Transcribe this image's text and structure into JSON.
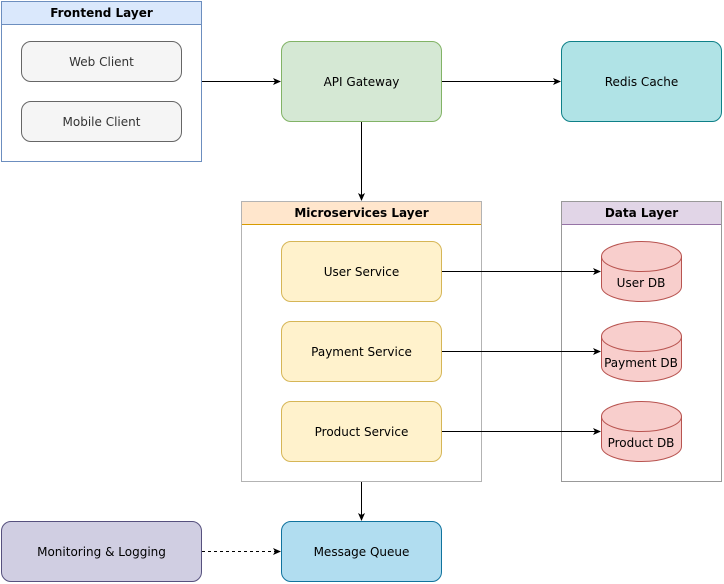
{
  "containers": {
    "frontend": {
      "title": "Frontend Layer",
      "fill": "#dae8fc",
      "stroke": "#6c8ebf"
    },
    "microservices": {
      "title": "Microservices Layer",
      "fill": "#ffe6cc",
      "stroke": "#d79b00"
    },
    "data": {
      "title": "Data Layer",
      "fill": "#e1d5e7",
      "stroke": "#9673a6"
    }
  },
  "nodes": {
    "web_client": "Web Client",
    "mobile_client": "Mobile Client",
    "api_gateway": "API Gateway",
    "redis_cache": "Redis Cache",
    "user_service": "User Service",
    "payment_service": "Payment Service",
    "product_service": "Product Service",
    "user_db": "User DB",
    "payment_db": "Payment DB",
    "product_db": "Product DB",
    "monitoring": "Monitoring & Logging",
    "message_queue": "Message Queue"
  }
}
